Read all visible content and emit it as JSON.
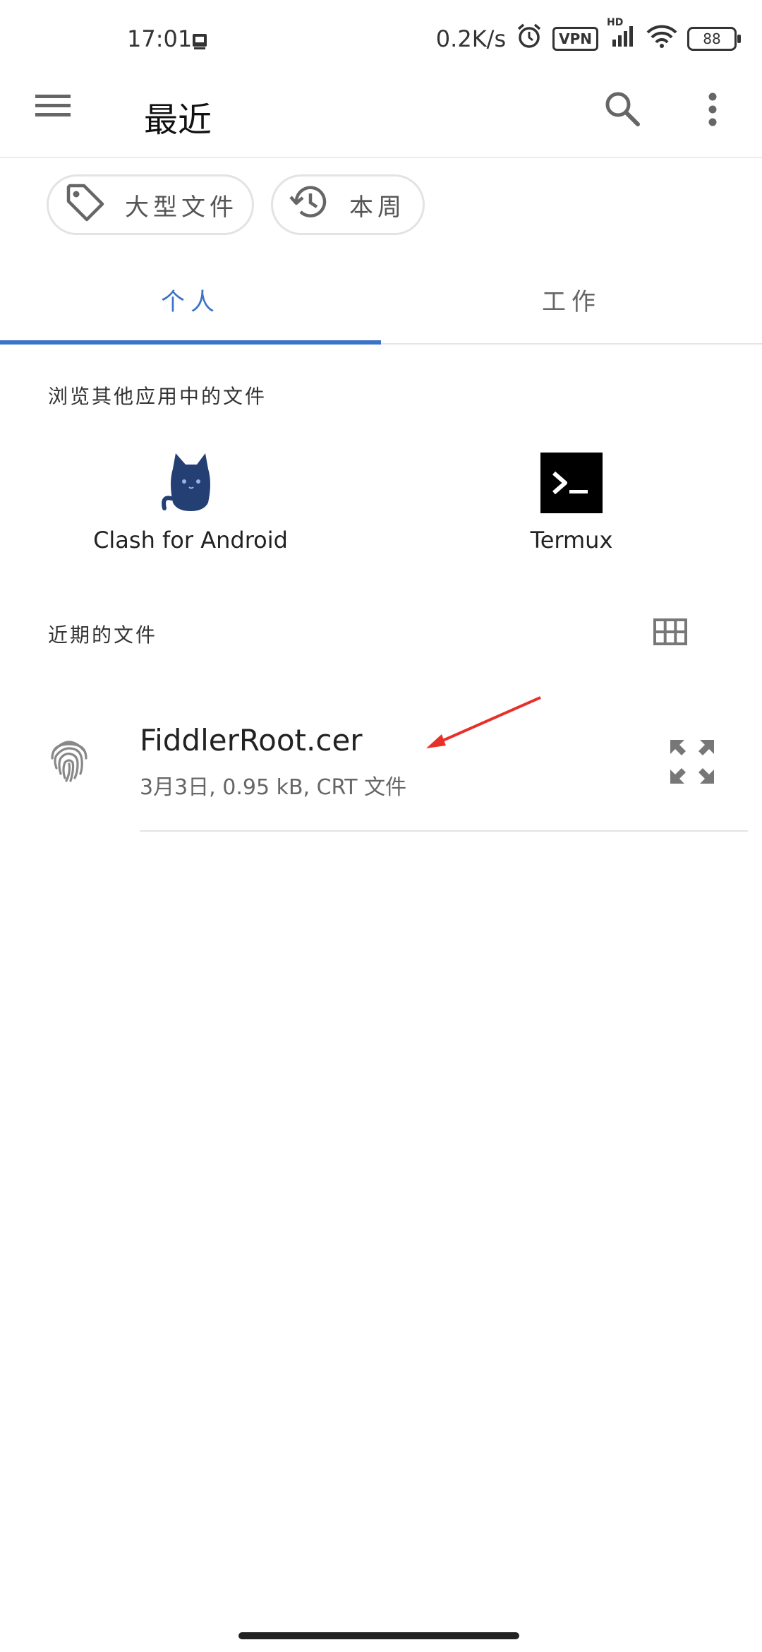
{
  "status_bar": {
    "time": "17:01",
    "network_speed": "0.2K/s",
    "vpn_label": "VPN",
    "hd_label": "HD",
    "battery": "88"
  },
  "app_bar": {
    "title": "最近",
    "menu_icon": "menu-icon",
    "search_icon": "search-icon",
    "more_icon": "more-vert-icon"
  },
  "filters": {
    "large_files": "大型文件",
    "this_week": "本周"
  },
  "tabs": [
    {
      "label": "个人",
      "active": true
    },
    {
      "label": "工作",
      "active": false
    }
  ],
  "browse": {
    "heading": "浏览其他应用中的文件",
    "apps": [
      {
        "name": "Clash for Android",
        "icon": "cat-icon"
      },
      {
        "name": "Termux",
        "icon": "terminal-icon"
      }
    ]
  },
  "recent": {
    "heading": "近期的文件",
    "view_icon": "grid-view-icon",
    "files": [
      {
        "name": "FiddlerRoot.cer",
        "meta": "3月3日, 0.95 kB, CRT 文件",
        "icon": "fingerprint-icon"
      }
    ]
  },
  "colors": {
    "accent": "#3b73c7",
    "annotation_arrow": "#e8302a",
    "clash_blue": "#233f73"
  }
}
